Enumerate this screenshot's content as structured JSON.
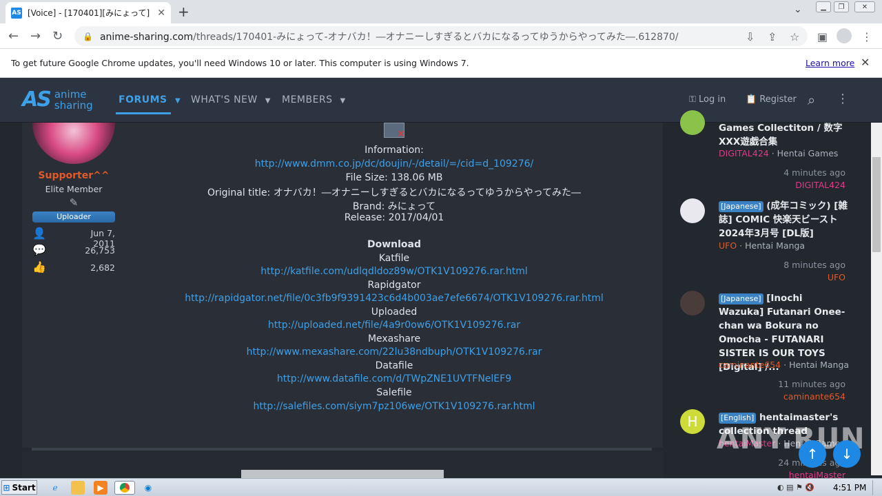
{
  "browser": {
    "tab_title": "[Voice] - [170401][みにょって] オナバカ！―",
    "favicon_text": "AS",
    "url_domain": "anime-sharing.com",
    "url_path": "/threads/170401-みにょって-オナバカ！―オナニーしすぎるとバカになるってゆうからやってみた―.612870/",
    "info_message": "To get future Google Chrome updates, you'll need Windows 10 or later. This computer is using Windows 7.",
    "learn_more": "Learn more"
  },
  "site": {
    "logo_mark": "AS",
    "logo_line1": "anime",
    "logo_line2": "sharing",
    "nav": {
      "forums": "FORUMS",
      "whats_new": "WHAT'S NEW",
      "members": "MEMBERS"
    },
    "login": "Log in",
    "register": "Register"
  },
  "user": {
    "name": "Supporter^^",
    "title": "Elite Member",
    "badge": "Uploader",
    "joined": "Jun 7, 2011",
    "messages": "26,753",
    "reactions": "2,682"
  },
  "post": {
    "info_label": "Information:",
    "dmm_link": "http://www.dmm.co.jp/dc/doujin/-/detail/=/cid=d_109276/",
    "file_size": "File Size: 138.06 MB",
    "original_title": "Original title: オナバカ！―オナニーしすぎるとバカになるってゆうからやってみた―",
    "brand": "Brand: みにょって",
    "release": "Release: 2017/04/01",
    "download": "Download",
    "hosts": [
      {
        "name": "Katfile",
        "link": "http://katfile.com/udlqdldoz89w/OTK1V109276.rar.html"
      },
      {
        "name": "Rapidgator",
        "link": "http://rapidgator.net/file/0c3fb9f9391423c6d4b003ae7efe6674/OTK1V109276.rar.html"
      },
      {
        "name": "Uploaded",
        "link": "http://uploaded.net/file/4a9r0ow6/OTK1V109276.rar"
      },
      {
        "name": "Mexashare",
        "link": "http://www.mexashare.com/22lu38ndbuph/OTK1V109276.rar"
      },
      {
        "name": "Datafile",
        "link": "http://www.datafile.com/d/TWpZNE1UVTFNelEF9"
      },
      {
        "name": "Salefile",
        "link": "http://salefiles.com/siym7pz106we/OTK1V109276.rar.html"
      }
    ]
  },
  "sidebar": [
    {
      "title": "Games Collectiton / 数字XXX遊戯合集",
      "user": "DIGITAL424",
      "forum": "Hentai Games",
      "time": "4 minutes ago"
    },
    {
      "tag": "[Japanese]",
      "title": "(成年コミック) [雑誌] COMIC 快楽天ビースト 2024年3月号 [DL版]",
      "user": "UFO",
      "forum": "Hentai Manga",
      "time": "8 minutes ago"
    },
    {
      "tag": "[Japanese]",
      "title": "[Inochi Wazuka] Futanari Onee-chan wa Bokura no Omocha - FUTANARI SISTER IS OUR TOYS [Digital] /...",
      "user": "caminante654",
      "forum": "Hentai Manga",
      "time": "11 minutes ago"
    },
    {
      "tag": "[English]",
      "title": "hentaimaster's collection thread",
      "user": "hentaiMaster",
      "forum": "Hentai Games",
      "time": "24 minutes ago",
      "avatar_letter": "H"
    }
  ],
  "watermark": "ANY.RUN",
  "taskbar": {
    "start": "Start",
    "clock": "4:51 PM"
  }
}
